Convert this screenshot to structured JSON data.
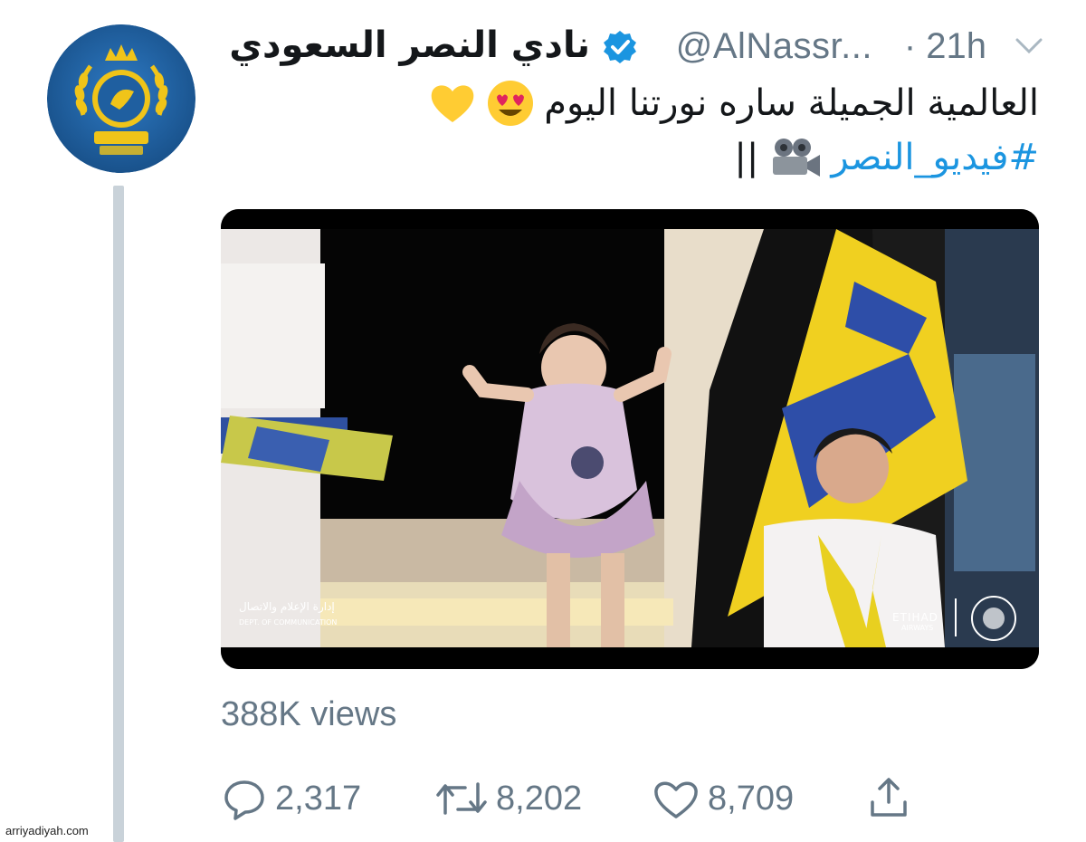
{
  "tweet": {
    "display_name": "نادي النصر السعودي",
    "handle": "@AlNassr...",
    "time": "· 21h",
    "text_line1": "العالمية الجميلة ساره نورتنا اليوم",
    "hashtag": "#فيديو_النصر",
    "text_tail": "||",
    "verified": true
  },
  "video": {
    "overlay_text_right": "ETIHAD",
    "overlay_text_right_sub": "AIRWAYS",
    "overlay_text_left": "إدارة الإعلام والاتصال",
    "overlay_text_left_sub": "DEPT. OF COMMUNICATION"
  },
  "stats": {
    "views": "388K views",
    "replies": "2,317",
    "retweets": "8,202",
    "likes": "8,709"
  },
  "watermark": "arriyadiyah.com",
  "colors": {
    "blue": "#1b95e0",
    "gray": "#657786",
    "avatar_bg": "#1f5fa0",
    "gold": "#f0c419"
  },
  "icons": [
    "reply-icon",
    "retweet-icon",
    "like-icon",
    "share-icon",
    "verified-icon",
    "chevron-down-icon",
    "camera-icon"
  ]
}
